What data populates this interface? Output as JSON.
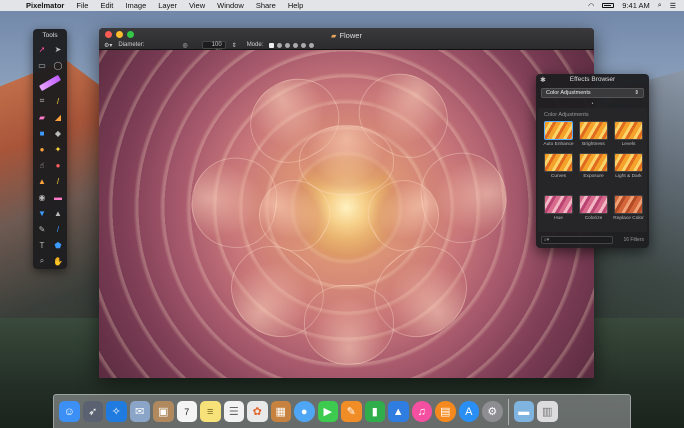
{
  "menubar": {
    "app_name": "Pixelmator",
    "menus": [
      "File",
      "Edit",
      "Image",
      "Layer",
      "View",
      "Window",
      "Share",
      "Help"
    ],
    "time": "9:41 AM"
  },
  "tools_palette": {
    "title": "Tools"
  },
  "window": {
    "title": "Flower",
    "toolbar": {
      "diameter_label": "Diameter:",
      "diameter_value": "100 px",
      "mode_label": "Mode:"
    }
  },
  "effects_browser": {
    "title": "Effects Browser",
    "category_selected": "Color Adjustments",
    "section_title": "Color Adjustments",
    "effects": [
      {
        "label": "Auto Enhance",
        "style": "fire",
        "selected": true
      },
      {
        "label": "Brightness",
        "style": "fire",
        "selected": false
      },
      {
        "label": "Levels",
        "style": "fire",
        "selected": false
      },
      {
        "label": "Curves",
        "style": "fire",
        "selected": false
      },
      {
        "label": "Exposure",
        "style": "fire",
        "selected": false
      },
      {
        "label": "Light & Dark",
        "style": "fire",
        "selected": false
      },
      {
        "label": "Hue",
        "style": "pink",
        "selected": false
      },
      {
        "label": "Colorize",
        "style": "pink",
        "selected": false
      },
      {
        "label": "Replace Color",
        "style": "rust",
        "selected": false
      }
    ],
    "filter_count": "16 Filters"
  },
  "dock": {
    "apps": [
      {
        "name": "finder-icon",
        "color": "#3b8ff5"
      },
      {
        "name": "launchpad-icon",
        "color": "#5a6170"
      },
      {
        "name": "safari-icon",
        "color": "#1f7be0"
      },
      {
        "name": "mail-icon",
        "color": "#8aa5c8"
      },
      {
        "name": "contacts-icon",
        "color": "#b08a5e"
      },
      {
        "name": "calendar-icon",
        "color": "#f4f4f4"
      },
      {
        "name": "notes-icon",
        "color": "#f7e27a"
      },
      {
        "name": "reminders-icon",
        "color": "#f2f2f2"
      },
      {
        "name": "photos-icon",
        "color": "#e9e9e9"
      },
      {
        "name": "pixelmator-icon",
        "color": "#c7823f"
      },
      {
        "name": "messages-icon",
        "color": "#4fa6f5"
      },
      {
        "name": "facetime-icon",
        "color": "#3ccb4f"
      },
      {
        "name": "pages-icon",
        "color": "#f08d26"
      },
      {
        "name": "numbers-icon",
        "color": "#2fae4b"
      },
      {
        "name": "keynote-icon",
        "color": "#2f7de0"
      },
      {
        "name": "itunes-icon",
        "color": "#f44fa1"
      },
      {
        "name": "ibooks-icon",
        "color": "#f5891e"
      },
      {
        "name": "app-store-icon",
        "color": "#2a8ff5"
      },
      {
        "name": "system-preferences-icon",
        "color": "#8d8d92"
      }
    ],
    "calendar_day": "7",
    "trailing": [
      {
        "name": "downloads-folder-icon",
        "color": "#7fb3e0"
      },
      {
        "name": "trash-icon",
        "color": "#dcdcdf"
      }
    ]
  }
}
